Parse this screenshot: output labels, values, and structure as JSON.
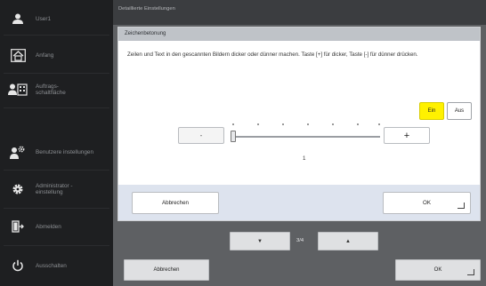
{
  "sidebar": {
    "user": "User1",
    "items": [
      {
        "label": "Anfang",
        "icon": "home-icon"
      },
      {
        "label": "Auftrags-\nschaltfläche",
        "icon": "job-status-icon"
      },
      {
        "label": "Benutzere instellungen",
        "icon": "user-settings-icon"
      },
      {
        "label": "Administrator -\neinstellung",
        "icon": "gear-icon"
      },
      {
        "label": "Abmelden",
        "icon": "logout-icon"
      },
      {
        "label": "Ausschalten",
        "icon": "power-icon"
      }
    ]
  },
  "header": {
    "title": "Detaillierte Einstellungen"
  },
  "dialog": {
    "title": "Zeichenbetonung",
    "description": "Zeilen und Text in den gescannten Bildern dicker oder dünner machen. Taste [+] für dicker, Taste [-] für dünner drücken.",
    "toggle_on": "Ein",
    "toggle_off": "Aus",
    "toggle_state": "Ein",
    "minus_label": "-",
    "plus_label": "+",
    "slider": {
      "value": "1",
      "min": 1,
      "max": 7,
      "current": 1
    },
    "cancel": "Abbrechen",
    "ok": "OK"
  },
  "pager": {
    "indicator": "3/4",
    "down_label": "▼",
    "up_label": "▲"
  },
  "footer": {
    "cancel": "Abbrechen",
    "ok": "OK"
  },
  "colors": {
    "accent_yellow": "#fff100",
    "sidebar_bg": "#1e1f21",
    "main_bg": "#5e6063"
  }
}
